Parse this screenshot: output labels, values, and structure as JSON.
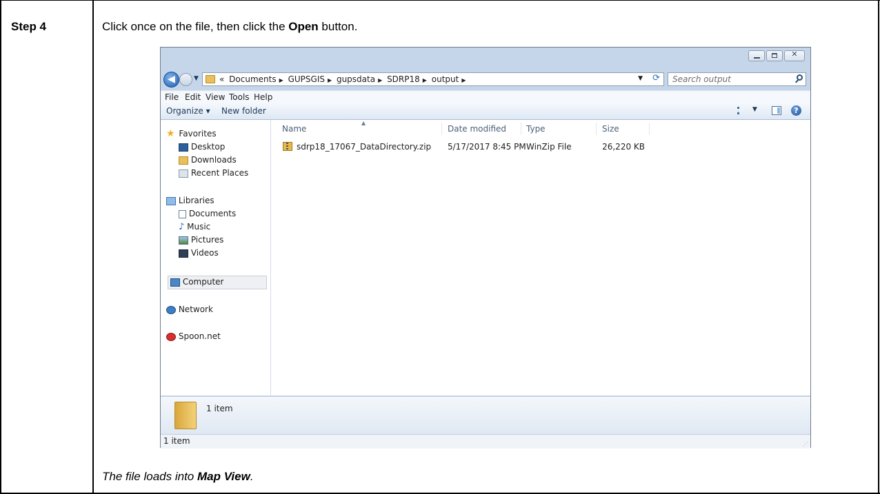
{
  "step": {
    "label": "Step 4",
    "instruction_pre": "Click once on the file, then click the ",
    "instruction_bold": "Open",
    "instruction_post": " button.",
    "result_pre": "The file loads into ",
    "result_bold": "Map View",
    "result_post": "."
  },
  "window": {
    "breadcrumb_prefix": "«",
    "breadcrumbs": [
      "Documents",
      "GUPSGIS",
      "gupsdata",
      "SDRP18",
      "output"
    ],
    "search_placeholder": "Search output",
    "menu": [
      "File",
      "Edit",
      "View",
      "Tools",
      "Help"
    ],
    "organize_label": "Organize ▾",
    "new_folder_label": "New folder",
    "nav": {
      "favorites": "Favorites",
      "desktop": "Desktop",
      "downloads": "Downloads",
      "recent_places": "Recent Places",
      "libraries": "Libraries",
      "documents": "Documents",
      "music": "Music",
      "pictures": "Pictures",
      "videos": "Videos",
      "computer": "Computer",
      "network": "Network",
      "spoon": "Spoon.net"
    },
    "columns": [
      "Name",
      "Date modified",
      "Type",
      "Size"
    ],
    "files": [
      {
        "name": "sdrp18_17067_DataDirectory.zip",
        "date": "5/17/2017 8:45 PM",
        "type": "WinZip File",
        "size": "26,220 KB"
      }
    ],
    "details_count": "1 item",
    "status_count": "1 item"
  },
  "icons": [
    "back-icon",
    "forward-icon",
    "folder-icon",
    "refresh-icon",
    "search-icon",
    "view-icon",
    "preview-pane-icon",
    "help-icon",
    "star-icon",
    "zip-icon",
    "computer-icon",
    "network-icon",
    "spoon-icon"
  ]
}
